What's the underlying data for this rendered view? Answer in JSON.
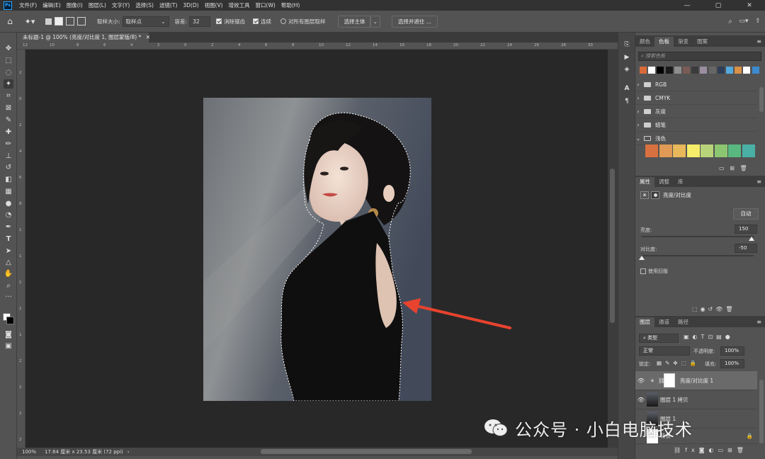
{
  "app": {
    "logo": "Ps"
  },
  "menu": [
    "文件(F)",
    "编辑(E)",
    "图像(I)",
    "图层(L)",
    "文字(Y)",
    "选择(S)",
    "滤镜(T)",
    "3D(D)",
    "视图(V)",
    "增效工具",
    "窗口(W)",
    "帮助(H)"
  ],
  "window_controls": {
    "minimize": "—",
    "maximize": "▢",
    "close": "✕"
  },
  "options": {
    "sample_size_label": "取样大小:",
    "sample_size_value": "取样点",
    "tolerance_label": "容差:",
    "tolerance_value": "32",
    "antialias_label": "消除锯齿",
    "contiguous_label": "连续",
    "sample_all_label": "对所有图层取样",
    "select_subject": "选择主体",
    "select_mask": "选择并遮住 ..."
  },
  "document": {
    "tab_title": "未标题-1 @ 100% (亮度/对比度 1, 图层蒙版/8) *",
    "zoom": "100%",
    "doc_info": "17.64 厘米 x 23.53 厘米 (72 ppi)",
    "ruler_top": [
      "12",
      "10",
      "8",
      "6",
      "4",
      "2",
      "0",
      "2",
      "4",
      "6",
      "8",
      "10",
      "12",
      "14",
      "16",
      "18",
      "20",
      "22",
      "24",
      "26",
      "28",
      "30"
    ],
    "ruler_left": [
      "2",
      "0",
      "2",
      "4",
      "6",
      "8",
      "1",
      "1",
      "1",
      "1",
      "1",
      "2",
      "2",
      "2",
      "2"
    ]
  },
  "swatches_panel": {
    "tabs": [
      "颜色",
      "色板",
      "渐变",
      "图案"
    ],
    "active_tab": "色板",
    "search_placeholder": "搜索色板",
    "recent_colors": [
      "#d86a3a",
      "#ffffff",
      "#000000",
      "#1b1b1b",
      "#8e8e8e",
      "#7a5b55",
      "#3b3b3b",
      "#9a8ea0",
      "#666666",
      "#2f3e56",
      "#55aadd",
      "#d89048",
      "#ffffff",
      "#3c8ad0"
    ],
    "groups": [
      "RGB",
      "CMYK",
      "灰度",
      "蜡笔",
      "浅色"
    ],
    "light_colors": [
      "#d9703f",
      "#e09a55",
      "#e8b85a",
      "#f6ee6a",
      "#b8d47a",
      "#8cc670",
      "#58b880",
      "#4ab0a6"
    ]
  },
  "properties_panel": {
    "tabs": [
      "属性",
      "调整",
      "库"
    ],
    "active_tab": "属性",
    "title": "亮度/对比度",
    "auto_label": "自动",
    "brightness_label": "亮度:",
    "brightness_value": "150",
    "contrast_label": "对比度:",
    "contrast_value": "-50",
    "legacy_label": "使用旧版",
    "brightness_slider_fraction": 0.98,
    "contrast_slider_fraction": 0.0
  },
  "layers_panel": {
    "tabs": [
      "图层",
      "通道",
      "路径"
    ],
    "active_tab": "图层",
    "filter_label": "类型",
    "blend_mode": "正常",
    "opacity_label": "不透明度:",
    "opacity_value": "100%",
    "lock_label": "锁定:",
    "fill_label": "填充:",
    "fill_value": "100%",
    "layers": [
      {
        "name": "亮度/对比度 1",
        "selected": true
      },
      {
        "name": "图层 1 拷贝",
        "selected": false
      },
      {
        "name": "图层 1",
        "selected": false
      },
      {
        "name": "背景",
        "selected": false
      }
    ]
  },
  "watermark": {
    "text": "公众号 · 小白电脑技术"
  },
  "colors": {
    "annotation_arrow": "#e8432e",
    "selection_marquee": "#ffffff"
  }
}
